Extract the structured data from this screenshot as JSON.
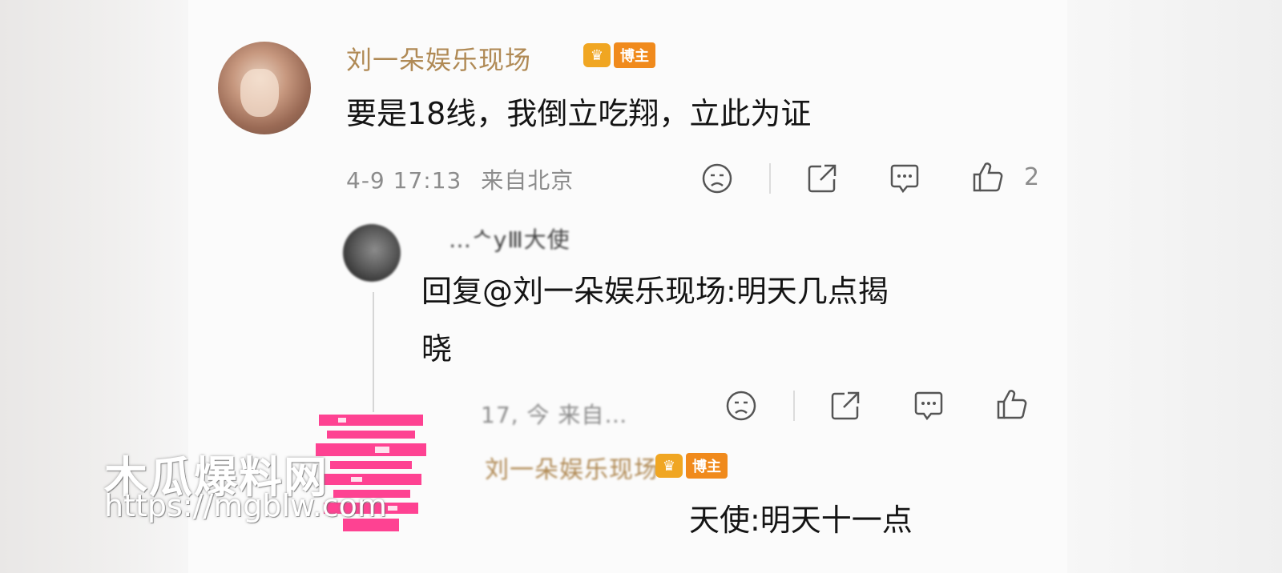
{
  "comment": {
    "username": "刘一朵娱乐现场",
    "badge_label": "博主",
    "text": "要是18线，我倒立吃翔，立此为证",
    "time": "4-9 17:13",
    "location": "来自北京",
    "like_count": "2",
    "icons": [
      "dislike-face-icon",
      "share-icon",
      "comment-icon",
      "like-thumb-icon"
    ]
  },
  "reply": {
    "username_partial": "…ᄉyⅢ大使",
    "text_line1": "回复@刘一朵娱乐现场:明天几点揭",
    "text_line2": "晓",
    "meta_partial": "17, 今 来自…",
    "icons": [
      "dislike-face-icon",
      "share-icon",
      "comment-icon",
      "like-thumb-icon"
    ]
  },
  "subreply": {
    "username_blurred": "刘一朵娱乐现场",
    "badge_label": "博主",
    "text": "天使:明天十一点"
  },
  "watermark": {
    "title": "木瓜爆料网",
    "url": "https://mgblw.com"
  },
  "colors": {
    "username": "#b08a55",
    "badge_orange": "#f08a1c",
    "crown": "#f0a622",
    "meta_gray": "#8c8c8c",
    "stamp_pink": "#ff2f87"
  }
}
